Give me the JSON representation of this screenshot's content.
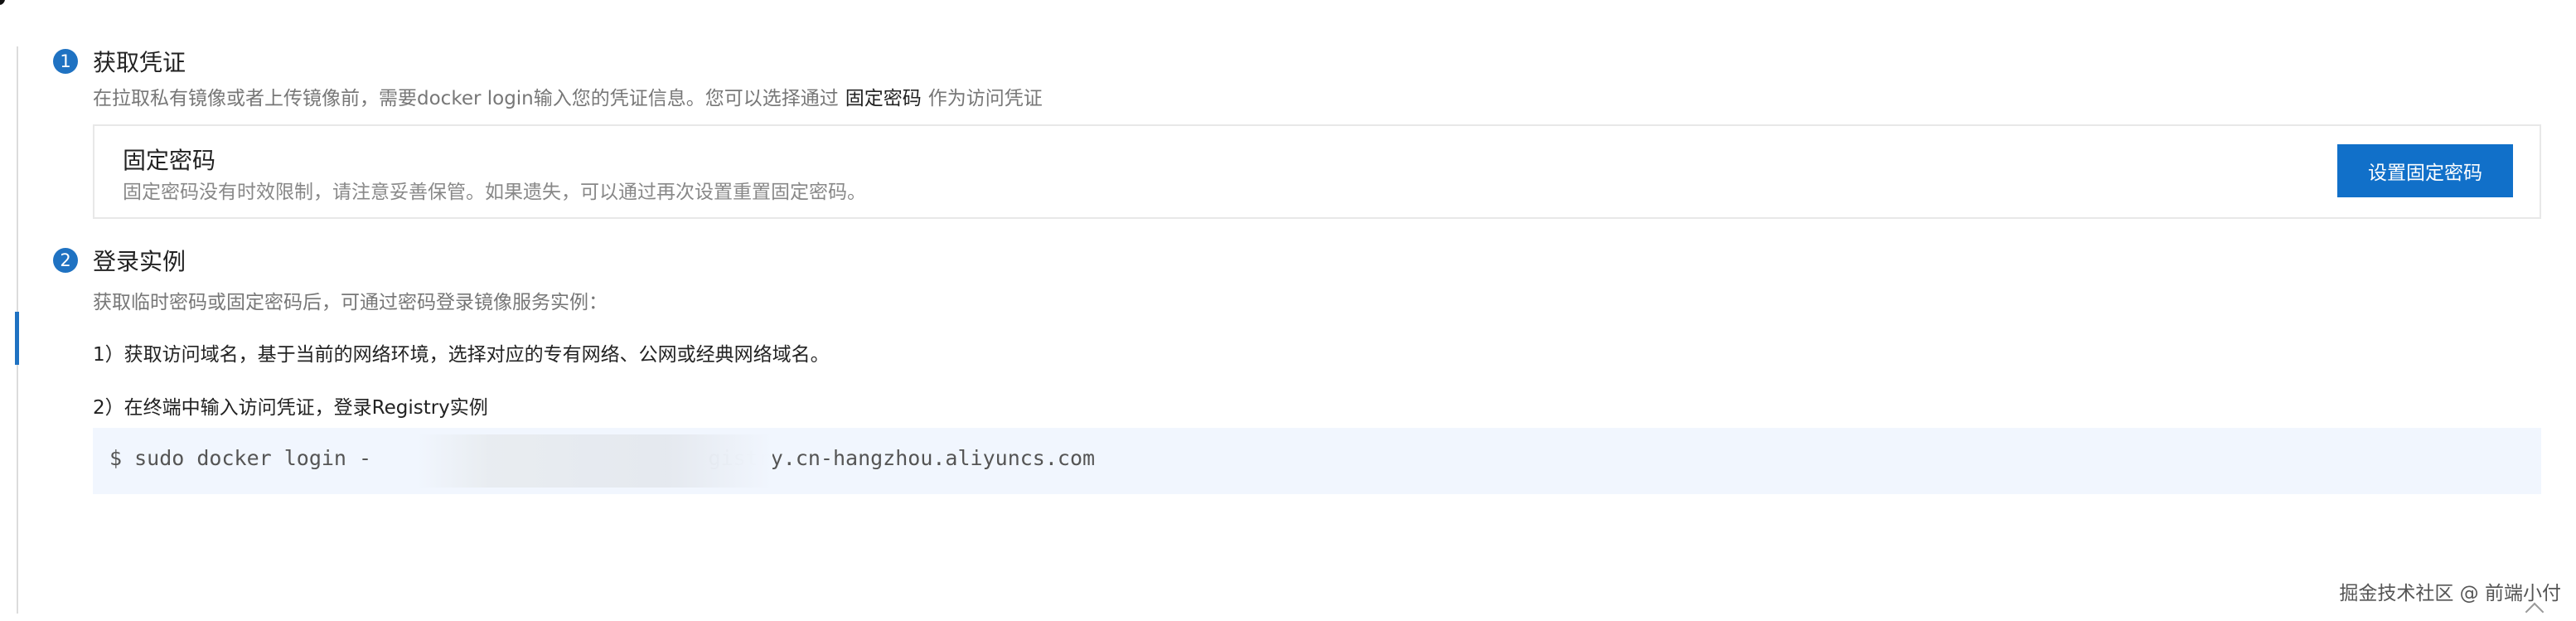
{
  "step1": {
    "number": "1",
    "title": "获取凭证",
    "desc_prefix": "在拉取私有镜像或者上传镜像前，需要docker login输入您的凭证信息。您可以选择通过",
    "desc_strong": "固定密码",
    "desc_suffix": "作为访问凭证",
    "card": {
      "title": "固定密码",
      "desc": "固定密码没有时效限制，请注意妥善保管。如果遗失，可以通过再次设置重置固定密码。",
      "button_label": "设置固定密码"
    }
  },
  "step2": {
    "number": "2",
    "title": "登录实例",
    "desc": "获取临时密码或固定密码后，可通过密码登录镜像服务实例：",
    "instruction_1": "1）获取访问域名，基于当前的网络环境，选择对应的专有网络、公网或经典网络域名。",
    "instruction_2": "2）在终端中输入访问凭证，登录Registry实例",
    "command": "$ sudo docker login -                           gistry.cn-hangzhou.aliyuncs.com"
  },
  "watermark": "掘金技术社区 @ 前端小付",
  "colors": {
    "accent": "#1f72c2",
    "button": "#1170c9",
    "code_bg": "#f1f6fe"
  }
}
